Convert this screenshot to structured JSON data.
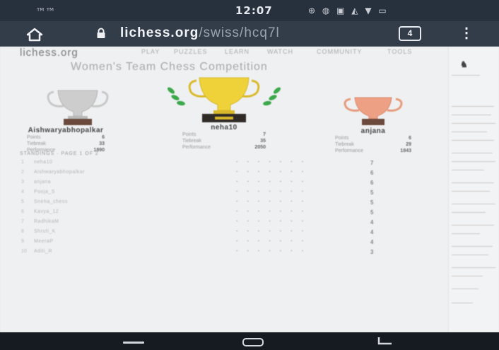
{
  "status_bar": {
    "carrier": "ᵀᴹ ᵀᴹ",
    "time": "12:07",
    "indicators": "⊕ ◍ ▣ ◭ ▼ ▭"
  },
  "browser": {
    "url_host": "lichess.org",
    "url_path": "/swiss/hcq7l",
    "tab_count": "4",
    "menu_glyph": "⋮",
    "icons": [
      "home-icon",
      "lock-icon",
      "tabs-icon",
      "menu-icon"
    ]
  },
  "site": {
    "logo": "lichess.org",
    "nav": [
      "PLAY",
      "PUZZLES",
      "LEARN",
      "WATCH",
      "COMMUNITY",
      "TOOLS"
    ],
    "event_title": "Women's Team Chess Competition"
  },
  "podium": {
    "first": {
      "name": "neha10",
      "stats": [
        [
          "Points",
          "7"
        ],
        [
          "Tiebreak",
          "35"
        ],
        [
          "Performance",
          "2050"
        ]
      ]
    },
    "second": {
      "name": "Aishwaryabhopalkar",
      "stats": [
        [
          "Points",
          "6"
        ],
        [
          "Tiebreak",
          "33"
        ],
        [
          "Performance",
          "1890"
        ]
      ]
    },
    "third": {
      "name": "anjana",
      "stats": [
        [
          "Points",
          "6"
        ],
        [
          "Tiebreak",
          "29"
        ],
        [
          "Performance",
          "1843"
        ]
      ]
    }
  },
  "standings": {
    "header": "STANDINGS · PAGE 1 OF 2",
    "rows": [
      {
        "pos": "1",
        "name": "neha10",
        "score": "7"
      },
      {
        "pos": "2",
        "name": "Aishwaryabhopalkar",
        "score": "6"
      },
      {
        "pos": "3",
        "name": "anjana",
        "score": "6"
      },
      {
        "pos": "4",
        "name": "Pooja_S",
        "score": "5"
      },
      {
        "pos": "5",
        "name": "Sneha_chess",
        "score": "5"
      },
      {
        "pos": "6",
        "name": "Kavya_12",
        "score": "5"
      },
      {
        "pos": "7",
        "name": "RadhikaM",
        "score": "4"
      },
      {
        "pos": "8",
        "name": "Shruti_K",
        "score": "4"
      },
      {
        "pos": "9",
        "name": "MeeraP",
        "score": "4"
      },
      {
        "pos": "10",
        "name": "Aditi_R",
        "score": "3"
      }
    ]
  },
  "colors": {
    "status_bar": "#27303d",
    "url_bar": "#333c49",
    "gold": "#efd23a",
    "silver": "#c8c8c8",
    "bronze": "#e69a7c",
    "laurel": "#3aa74a"
  },
  "system_nav": {
    "icons": [
      "recent-apps-icon",
      "home-button-icon",
      "back-icon"
    ]
  }
}
